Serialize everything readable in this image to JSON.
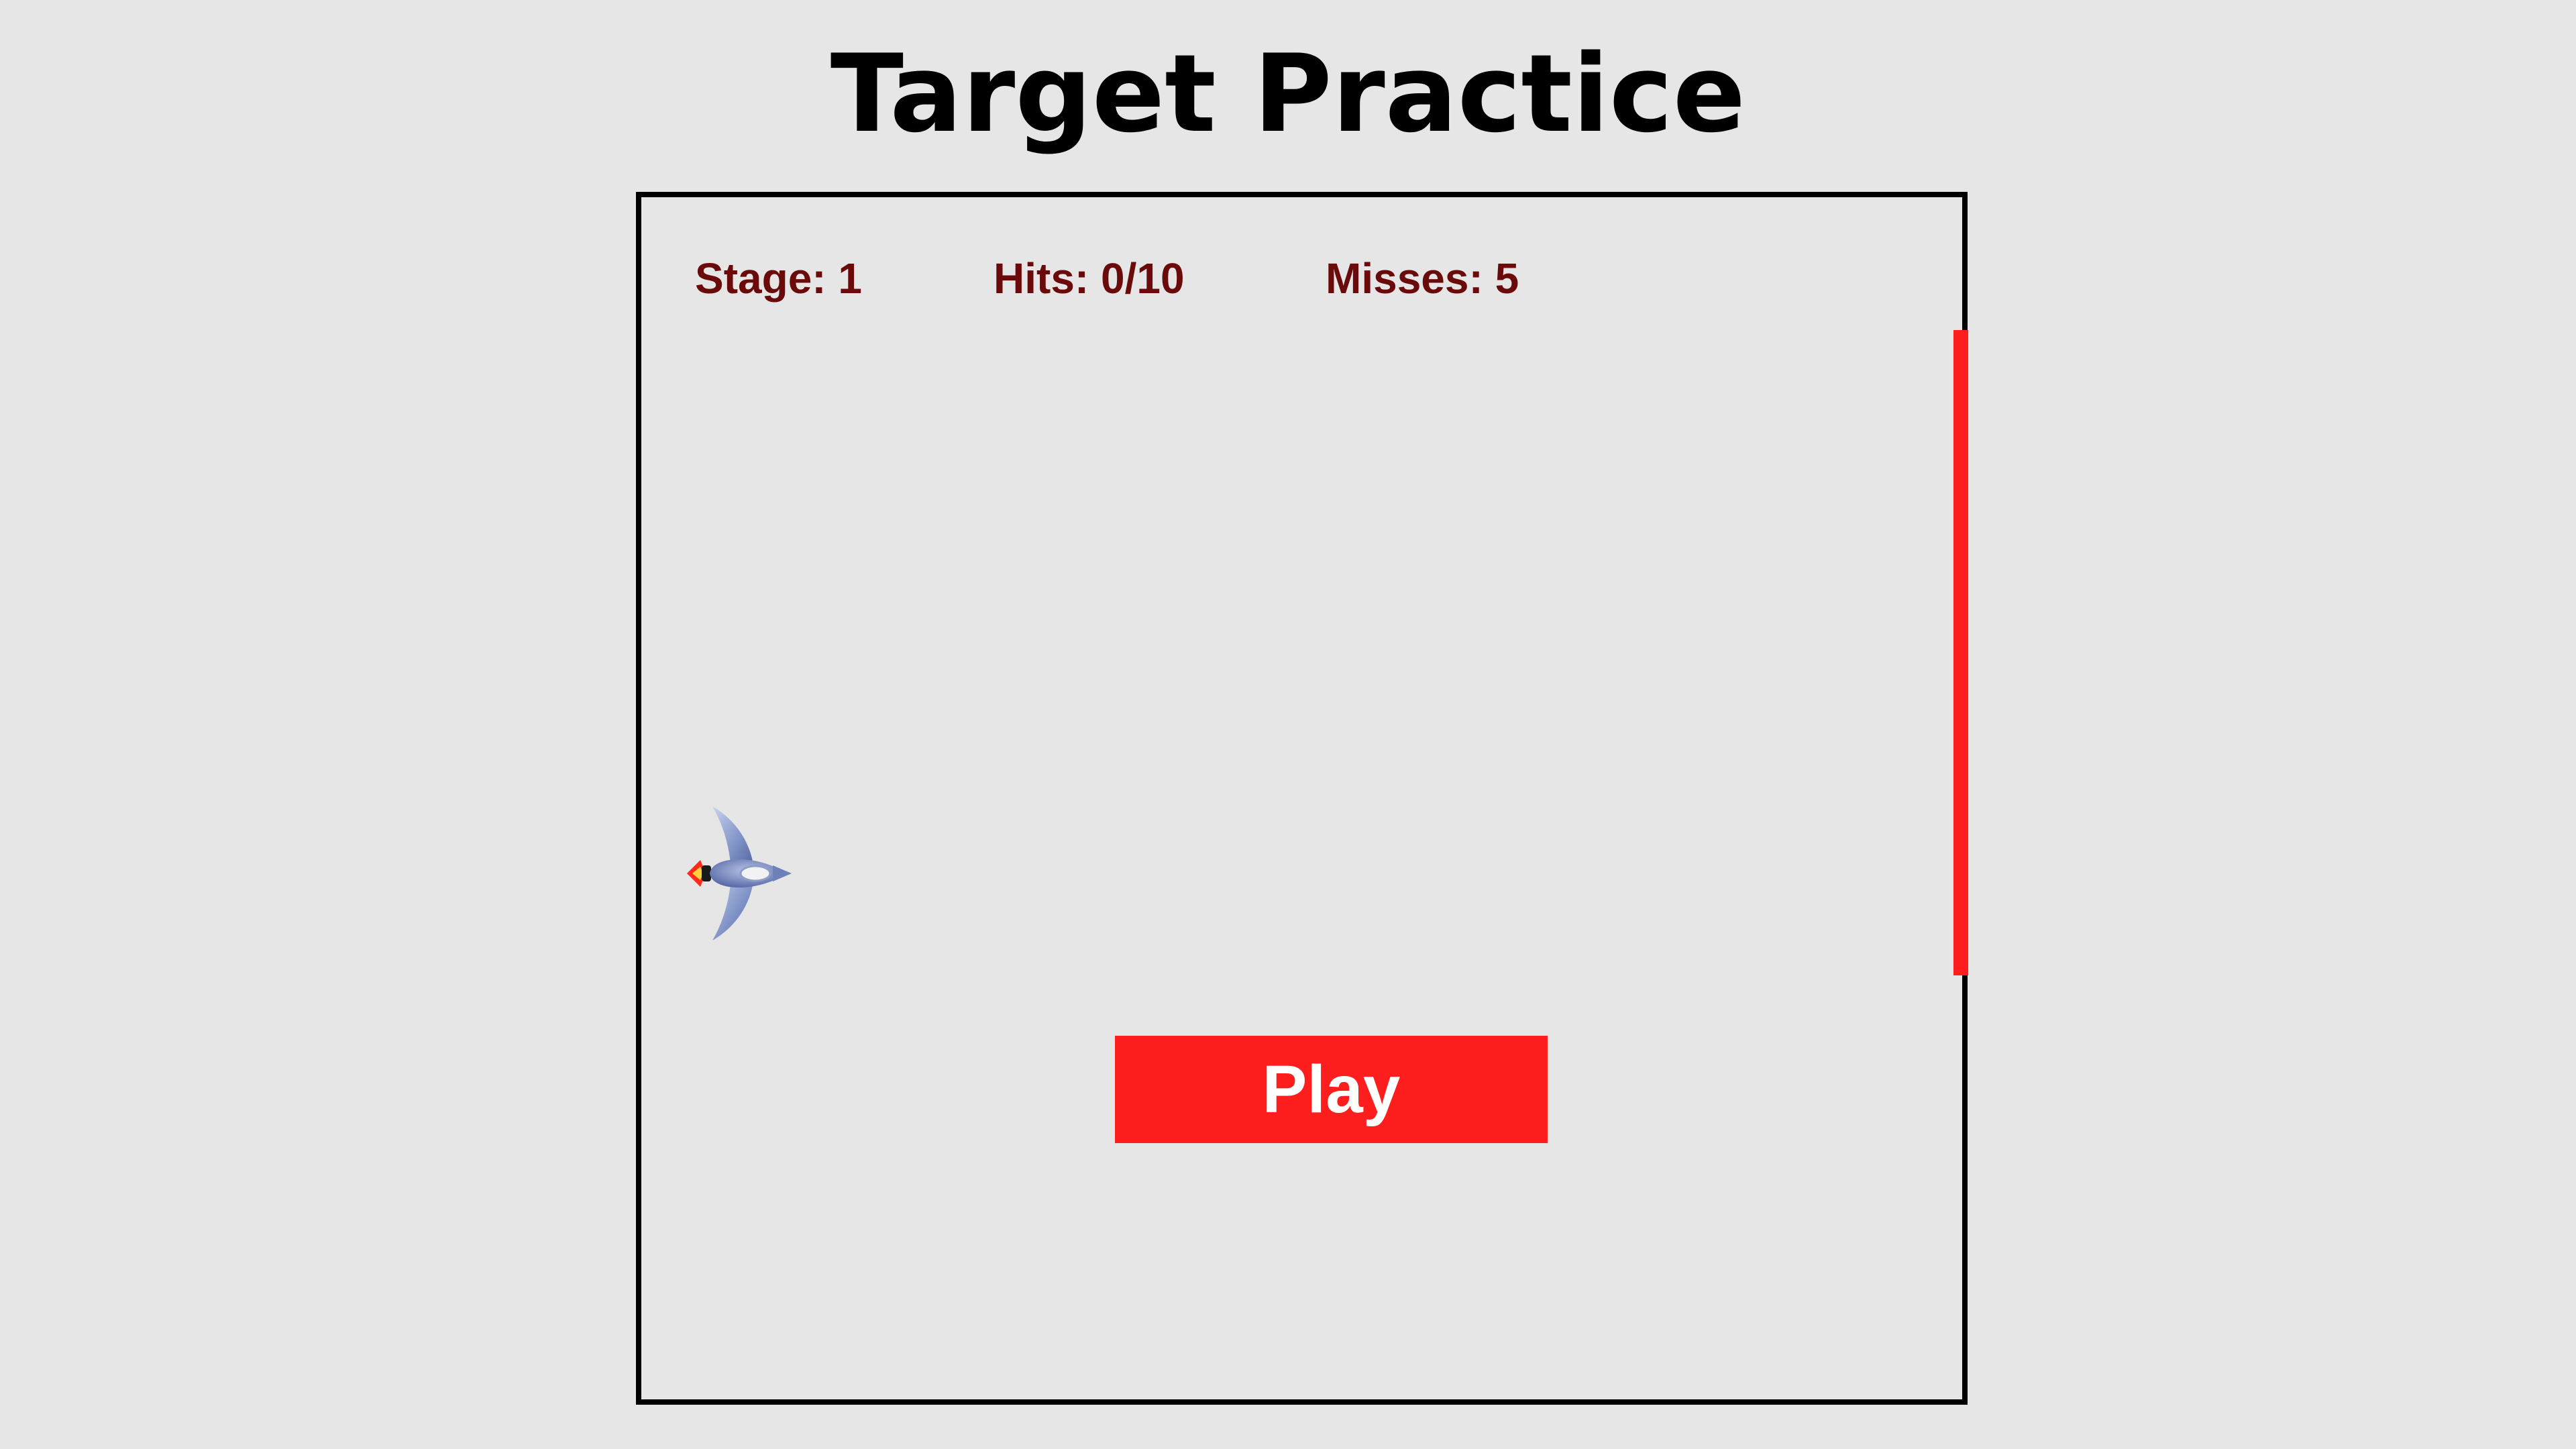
{
  "title": "Target Practice",
  "hud": {
    "stage": "Stage: 1",
    "hits": "Hits: 0/10",
    "misses": "Misses: 5"
  },
  "play_button": {
    "label": "Play"
  },
  "sprites": {
    "player": "spaceship-icon"
  },
  "colors": {
    "background": "#e6e6e6",
    "frame_border": "#000000",
    "hud_text": "#6b0a0a",
    "accent_red": "#ff1e1e",
    "button_text": "#ffffff",
    "ship_body": "#7b8fc4"
  }
}
